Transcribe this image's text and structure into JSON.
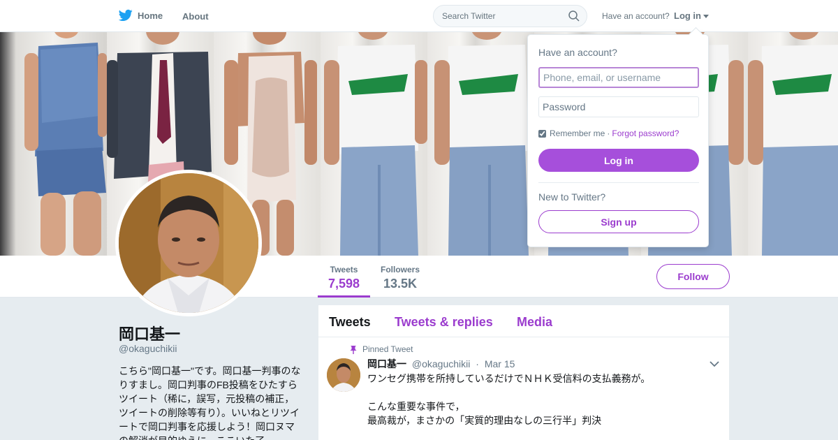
{
  "colors": {
    "accent": "#9b3cce",
    "button": "#a64fdb",
    "twitter_blue": "#1da1f2"
  },
  "nav": {
    "home_label": "Home",
    "about_label": "About",
    "search_placeholder": "Search Twitter",
    "have_account": "Have an account?",
    "login_label": "Log in"
  },
  "stats": [
    {
      "label": "Tweets",
      "value": "7,598"
    },
    {
      "label": "Followers",
      "value": "13.5K"
    }
  ],
  "follow_label": "Follow",
  "profile": {
    "name": "岡口基一",
    "handle": "@okaguchikii",
    "bio": "こちら\"岡口基一\"です。岡口基一判事のなりすまし。岡口判事のFB投稿をひたすらツイート（稀に，誤写，元投稿の補正，ツイートの削除等有り）。いいねとリツイートで岡口判事を応援しよう！岡口ヌマの解消が目的ゆえに，ここいた了"
  },
  "tabs": [
    "Tweets",
    "Tweets & replies",
    "Media"
  ],
  "tweet": {
    "pinned_label": "Pinned Tweet",
    "name": "岡口基一",
    "handle": "@okaguchikii",
    "date": "Mar 15",
    "text": "ワンセグ携帯を所持しているだけでＮＨＫ受信料の支払義務が。\n\nこんな重要な事件で，\n最高裁が，まさかの「実質的理由なしの三行半」判決"
  },
  "login_dropdown": {
    "title": "Have an account?",
    "username_placeholder": "Phone, email, or username",
    "password_placeholder": "Password",
    "remember_label": "Remember me",
    "separator": "·",
    "forgot_label": "Forgot password?",
    "login_button": "Log in",
    "new_label": "New to Twitter?",
    "signup_button": "Sign up"
  }
}
